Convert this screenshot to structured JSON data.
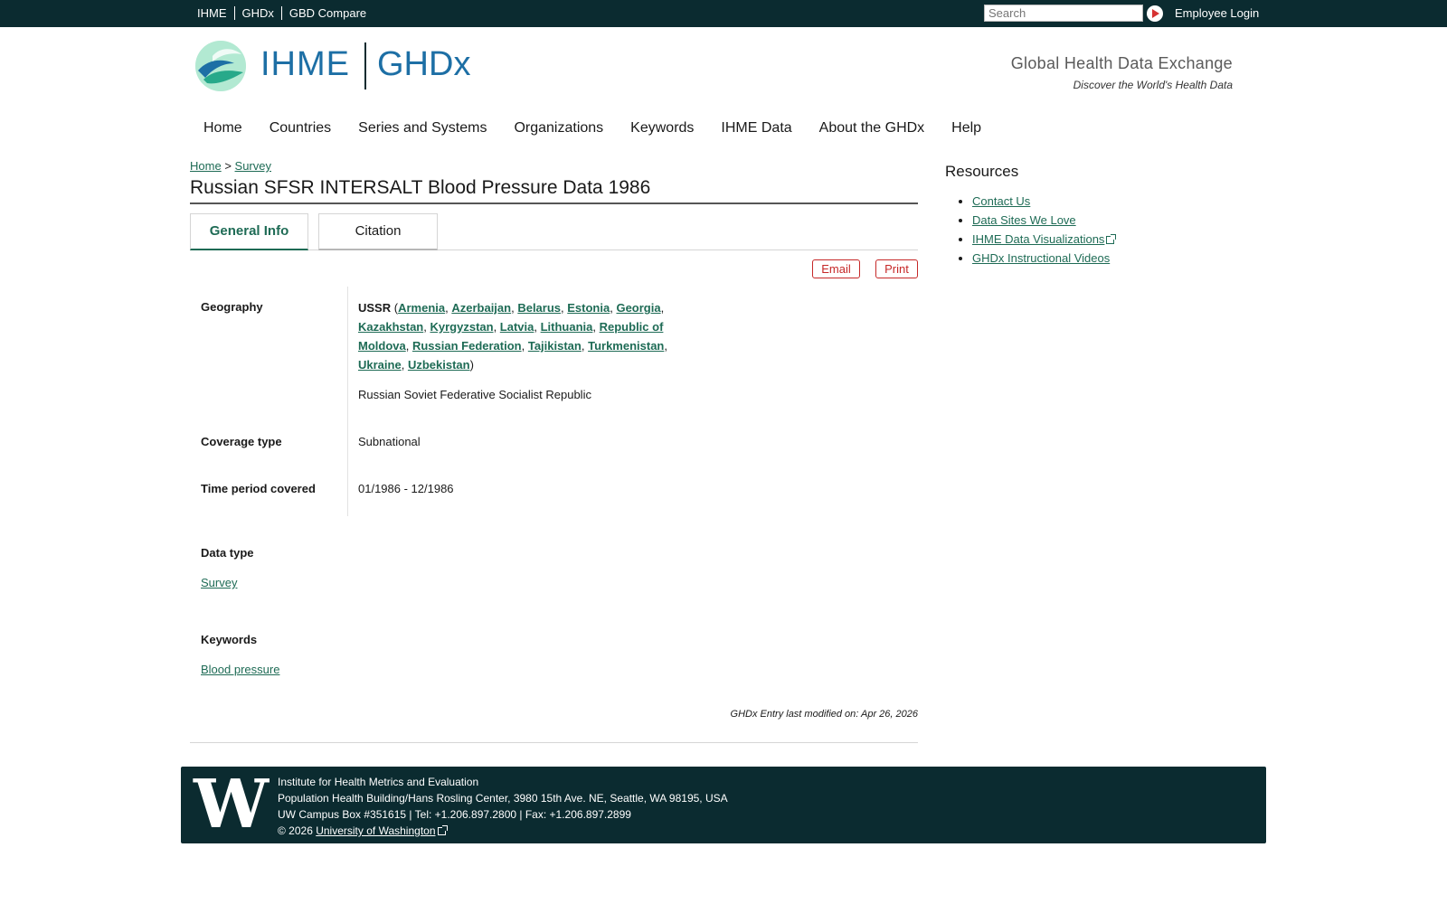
{
  "topbar": {
    "links": [
      "IHME",
      "GHDx",
      "GBD Compare"
    ],
    "search_placeholder": "Search",
    "employee_login": "Employee Login"
  },
  "header": {
    "logo_ihme": "IHME",
    "logo_ghdx": "GHDx",
    "tagline_title": "Global Health Data Exchange",
    "tagline_sub": "Discover the World's Health Data"
  },
  "nav": {
    "items": [
      "Home",
      "Countries",
      "Series and Systems",
      "Organizations",
      "Keywords",
      "IHME Data",
      "About the GHDx",
      "Help"
    ]
  },
  "breadcrumb": {
    "home": "Home",
    "separator": ">",
    "current": "Survey"
  },
  "page": {
    "title": "Russian SFSR INTERSALT Blood Pressure Data 1986",
    "tabs": [
      "General Info",
      "Citation"
    ],
    "email_button": "Email",
    "print_button": "Print"
  },
  "fields": {
    "geography_label": "Geography",
    "geography_parent": "USSR",
    "geography_countries": [
      "Armenia",
      "Azerbaijan",
      "Belarus",
      "Estonia",
      "Georgia",
      "Kazakhstan",
      "Kyrgyzstan",
      "Latvia",
      "Lithuania",
      "Republic of Moldova",
      "Russian Federation",
      "Tajikistan",
      "Turkmenistan",
      "Ukraine",
      "Uzbekistan"
    ],
    "geography_description": "Russian Soviet Federative Socialist Republic",
    "coverage_label": "Coverage type",
    "coverage_value": "Subnational",
    "time_label": "Time period covered",
    "time_value": "01/1986 - 12/1986",
    "data_type_label": "Data type",
    "data_type_value": "Survey",
    "keywords_label": "Keywords",
    "keywords_value": "Blood pressure",
    "modified": "GHDx Entry last modified on: Apr 26, 2026"
  },
  "sidebar": {
    "title": "Resources",
    "links": [
      "Contact Us",
      "Data Sites We Love",
      "IHME Data Visualizations",
      "GHDx Instructional Videos"
    ]
  },
  "footer": {
    "logo_letter": "W",
    "line1": "Institute for Health Metrics and Evaluation",
    "line2": "Population Health Building/Hans Rosling Center, 3980 15th Ave. NE, Seattle, WA 98195, USA",
    "line3": "UW Campus Box #351615 | Tel: +1.206.897.2800 | Fax: +1.206.897.2899",
    "copyright": "© 2026",
    "uw_link": "University of Washington"
  },
  "colors": {
    "topbar_bg": "#0b2b30",
    "link_green": "#1e6b55",
    "logo_blue": "#1d6fa5",
    "button_red": "#c62828"
  }
}
